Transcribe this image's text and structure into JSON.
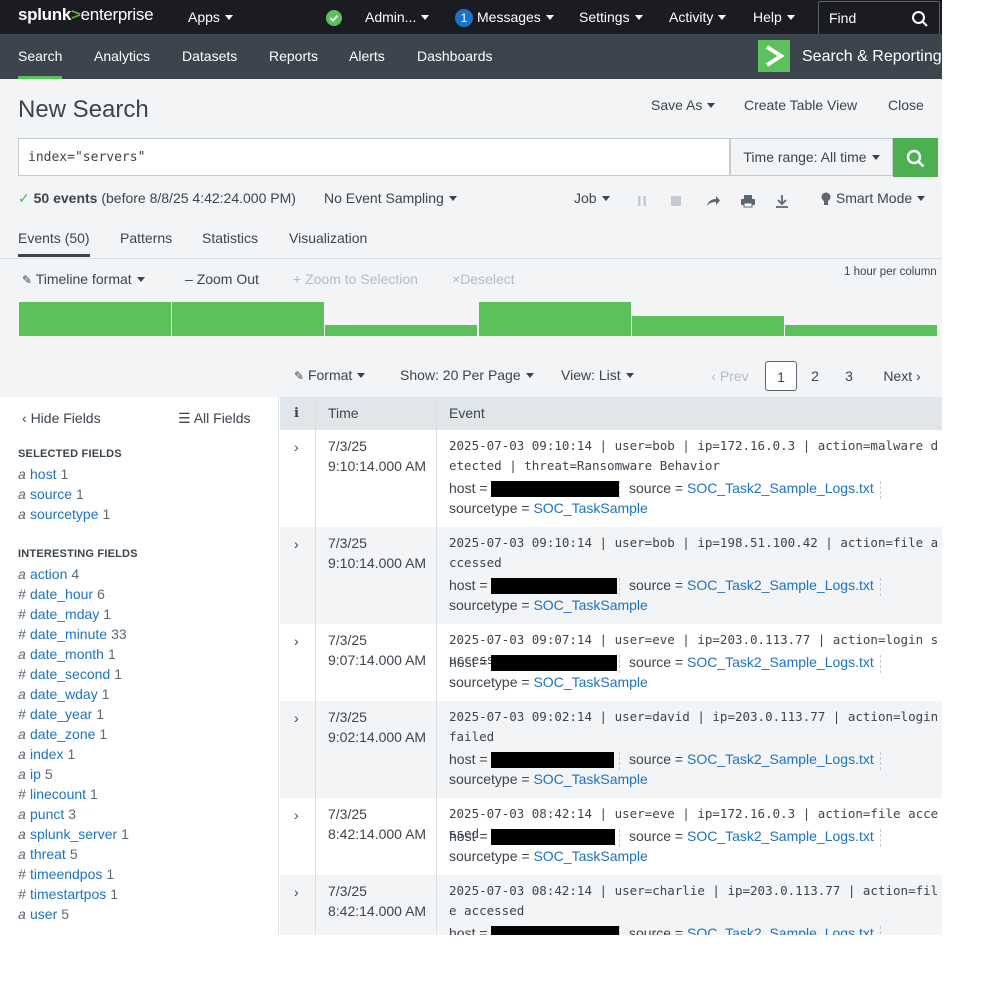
{
  "topbar": {
    "logo_splunk": "splunk",
    "logo_gt": ">",
    "logo_enterprise": "enterprise",
    "apps": "Apps",
    "admin": "Admin...",
    "messages_count": "1",
    "messages": "Messages",
    "settings": "Settings",
    "activity": "Activity",
    "help": "Help",
    "find": "Find"
  },
  "appbar": {
    "tabs": [
      "Search",
      "Analytics",
      "Datasets",
      "Reports",
      "Alerts",
      "Dashboards"
    ],
    "app_name": "Search & Reporting"
  },
  "header": {
    "title": "New Search",
    "save_as": "Save As",
    "create_table_view": "Create Table View",
    "close": "Close",
    "query": "index=\"servers\"",
    "time_range": "Time range: All time"
  },
  "status": {
    "events_count": "50 events",
    "before": "(before 8/8/25 4:42:24.000 PM)",
    "sampling": "No Event Sampling",
    "job": "Job",
    "mode": "Smart Mode"
  },
  "tabs": {
    "events": "Events (50)",
    "patterns": "Patterns",
    "statistics": "Statistics",
    "visualization": "Visualization"
  },
  "timeline": {
    "format": "Timeline format",
    "zoom_out": "Zoom Out",
    "zoom_selection": "Zoom to Selection",
    "deselect": "Deselect",
    "per_column": "1 hour per column",
    "bar_levels": [
      1.0,
      1.0,
      0.33,
      1.0,
      0.6,
      0.33
    ],
    "color": "#5cc05c"
  },
  "results": {
    "format": "Format",
    "show": "Show: 20 Per Page",
    "view": "View: List",
    "prev": "Prev",
    "pages": [
      "1",
      "2",
      "3"
    ],
    "current_page": "1",
    "next": "Next"
  },
  "sidebar": {
    "hide_fields": "Hide Fields",
    "all_fields": "All Fields",
    "selected_heading": "SELECTED FIELDS",
    "selected": [
      {
        "type": "a",
        "name": "host",
        "count": "1"
      },
      {
        "type": "a",
        "name": "source",
        "count": "1"
      },
      {
        "type": "a",
        "name": "sourcetype",
        "count": "1"
      }
    ],
    "interesting_heading": "INTERESTING FIELDS",
    "interesting": [
      {
        "type": "a",
        "name": "action",
        "count": "4"
      },
      {
        "type": "#",
        "name": "date_hour",
        "count": "6"
      },
      {
        "type": "#",
        "name": "date_mday",
        "count": "1"
      },
      {
        "type": "#",
        "name": "date_minute",
        "count": "33"
      },
      {
        "type": "a",
        "name": "date_month",
        "count": "1"
      },
      {
        "type": "#",
        "name": "date_second",
        "count": "1"
      },
      {
        "type": "a",
        "name": "date_wday",
        "count": "1"
      },
      {
        "type": "#",
        "name": "date_year",
        "count": "1"
      },
      {
        "type": "a",
        "name": "date_zone",
        "count": "1"
      },
      {
        "type": "a",
        "name": "index",
        "count": "1"
      },
      {
        "type": "a",
        "name": "ip",
        "count": "5"
      },
      {
        "type": "#",
        "name": "linecount",
        "count": "1"
      },
      {
        "type": "a",
        "name": "punct",
        "count": "3"
      },
      {
        "type": "a",
        "name": "splunk_server",
        "count": "1"
      },
      {
        "type": "a",
        "name": "threat",
        "count": "5"
      },
      {
        "type": "#",
        "name": "timeendpos",
        "count": "1"
      },
      {
        "type": "#",
        "name": "timestartpos",
        "count": "1"
      },
      {
        "type": "a",
        "name": "user",
        "count": "5"
      }
    ]
  },
  "table": {
    "col_info": "i",
    "col_time": "Time",
    "col_event": "Event",
    "meta_host": "host =",
    "meta_source": "source =",
    "meta_sourcetype": "sourcetype =",
    "source_value": "SOC_Task2_Sample_Logs.txt",
    "sourcetype_value": "SOC_TaskSample",
    "events": [
      {
        "date": "7/3/25",
        "time": "9:10:14.000 AM",
        "raw": "2025-07-03 09:10:14 | user=bob | ip=172.16.0.3 | action=malware detected | threat=Ransomware Behavior"
      },
      {
        "date": "7/3/25",
        "time": "9:10:14.000 AM",
        "raw": "2025-07-03 09:10:14 | user=bob | ip=198.51.100.42 | action=file accessed"
      },
      {
        "date": "7/3/25",
        "time": "9:07:14.000 AM",
        "raw": "2025-07-03 09:07:14 | user=eve | ip=203.0.113.77 | action=login success"
      },
      {
        "date": "7/3/25",
        "time": "9:02:14.000 AM",
        "raw": "2025-07-03 09:02:14 | user=david | ip=203.0.113.77 | action=login failed"
      },
      {
        "date": "7/3/25",
        "time": "8:42:14.000 AM",
        "raw": "2025-07-03 08:42:14 | user=eve | ip=172.16.0.3 | action=file accessed"
      },
      {
        "date": "7/3/25",
        "time": "8:42:14.000 AM",
        "raw": "2025-07-03 08:42:14 | user=charlie | ip=203.0.113.77 | action=file accessed"
      }
    ]
  }
}
